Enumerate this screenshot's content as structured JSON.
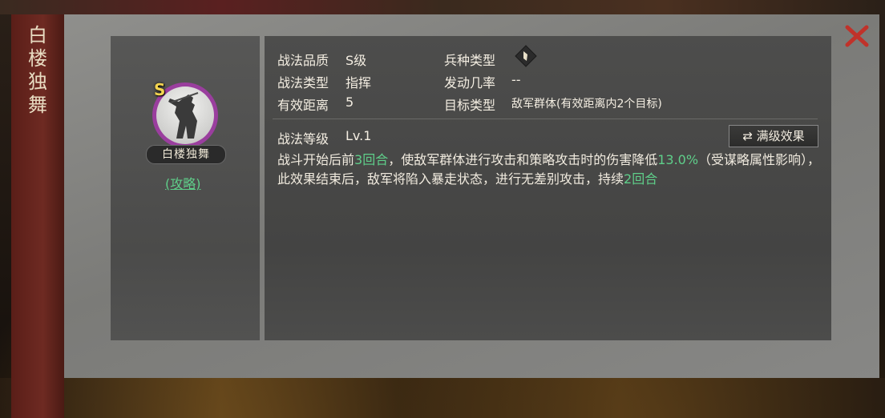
{
  "dialog": {
    "title_chars": [
      "白",
      "楼",
      "独",
      "舞"
    ]
  },
  "portrait": {
    "grade": "S",
    "name": "白楼独舞",
    "guide_link": "(攻略)"
  },
  "attributes": {
    "quality_label": "战法品质",
    "quality_value": "S级",
    "type_label": "战法类型",
    "type_value": "指挥",
    "range_label": "有效距离",
    "range_value": "5",
    "troop_label": "兵种类型",
    "troop_icon": "troop-type-icon",
    "rate_label": "发动几率",
    "rate_value": "--",
    "target_label": "目标类型",
    "target_value": "敌军群体(有效距离内2个目标)"
  },
  "level": {
    "label": "战法等级",
    "value": "Lv.1",
    "full_effect_button": "满级效果",
    "swap_icon": "swap-arrows-icon"
  },
  "description": {
    "part1": "战斗开始后前",
    "rounds1": "3回合",
    "part2": "，使敌军群体进行攻击和策略攻击时的伤害降低",
    "percent": "13.0%",
    "part3": "（受谋略属性影响），此效果结束后，敌军将陷入暴走状态，进行无差别攻击，持续",
    "rounds2": "2回合"
  },
  "colors": {
    "highlight": "#5fcf8a",
    "grade": "#f3d451",
    "close": "#c0322a"
  }
}
